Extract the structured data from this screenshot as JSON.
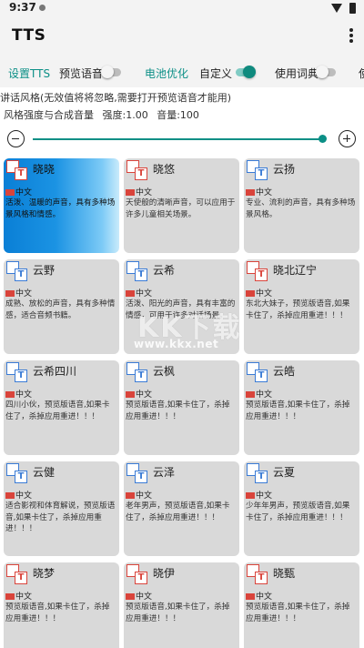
{
  "status": {
    "time": "9:37"
  },
  "app": {
    "title": "TTS"
  },
  "tabs": {
    "settings": "设置TTS",
    "preview": "预览语音",
    "battery": "电池优化",
    "custom": "自定义",
    "dictionary": "使用词典",
    "more": "使"
  },
  "switches": {
    "preview": false,
    "custom": true,
    "dictionary": false
  },
  "style": {
    "label": "讲话风格(无效值将将忽略,需要打开预览语音才能用)",
    "strength_label": "风格强度与合成音量",
    "strength_value": "强度:1.00",
    "volume_value": "音量:100"
  },
  "slider": {
    "value_fraction": 0.99
  },
  "voices": [
    {
      "name": "晓晓",
      "lang": "中文",
      "desc": "活泼、温暖的声音，具有多种场景风格和情感。",
      "icon": "red",
      "selected": true
    },
    {
      "name": "晓悠",
      "lang": "中文",
      "desc": "天使般的清晰声音，可以应用于许多儿童相关场景。",
      "icon": "red",
      "selected": false
    },
    {
      "name": "云扬",
      "lang": "中文",
      "desc": "专业、流利的声音，具有多种场景风格。",
      "icon": "blue",
      "selected": false
    },
    {
      "name": "云野",
      "lang": "中文",
      "desc": "成熟、放松的声音，具有多种情感，适合音频书籍。",
      "icon": "blue",
      "selected": false
    },
    {
      "name": "云希",
      "lang": "中文",
      "desc": "活泼、阳光的声音，具有丰富的情感，可用于许多对话场景。",
      "icon": "blue",
      "selected": false
    },
    {
      "name": "晓北辽宁",
      "lang": "中文",
      "desc": "东北大妹子，预览版语音,如果卡住了，杀掉应用重进！！！",
      "icon": "red",
      "selected": false
    },
    {
      "name": "云希四川",
      "lang": "中文",
      "desc": "四川小伙，预览版语音,如果卡住了，杀掉应用重进！！！",
      "icon": "blue",
      "selected": false
    },
    {
      "name": "云枫",
      "lang": "中文",
      "desc": "预览版语音,如果卡住了，杀掉应用重进！！！",
      "icon": "blue",
      "selected": false
    },
    {
      "name": "云皓",
      "lang": "中文",
      "desc": "预览版语音,如果卡住了，杀掉应用重进！！！",
      "icon": "blue",
      "selected": false
    },
    {
      "name": "云健",
      "lang": "中文",
      "desc": "适合影视和体育解说，预览版语音,如果卡住了，杀掉应用重进！！！",
      "icon": "blue",
      "selected": false
    },
    {
      "name": "云泽",
      "lang": "中文",
      "desc": "老年男声，预览版语音,如果卡住了，杀掉应用重进！！！",
      "icon": "blue",
      "selected": false
    },
    {
      "name": "云夏",
      "lang": "中文",
      "desc": "少年年男声，预览版语音,如果卡住了，杀掉应用重进！！！",
      "icon": "blue",
      "selected": false
    },
    {
      "name": "晓梦",
      "lang": "中文",
      "desc": "预览版语音,如果卡住了，杀掉应用重进！！！",
      "icon": "red",
      "selected": false
    },
    {
      "name": "晓伊",
      "lang": "中文",
      "desc": "预览版语音,如果卡住了，杀掉应用重进！！！",
      "icon": "red",
      "selected": false
    },
    {
      "name": "晓甄",
      "lang": "中文",
      "desc": "预览版语音,如果卡住了，杀掉应用重进！！！",
      "icon": "red",
      "selected": false
    }
  ],
  "watermark": {
    "text": "KK下载",
    "url": "www.kkx.net"
  },
  "colors": {
    "accent": "#0b8f86",
    "selected_card": "#0a7fd6",
    "card_bg": "#d9d9d9"
  }
}
